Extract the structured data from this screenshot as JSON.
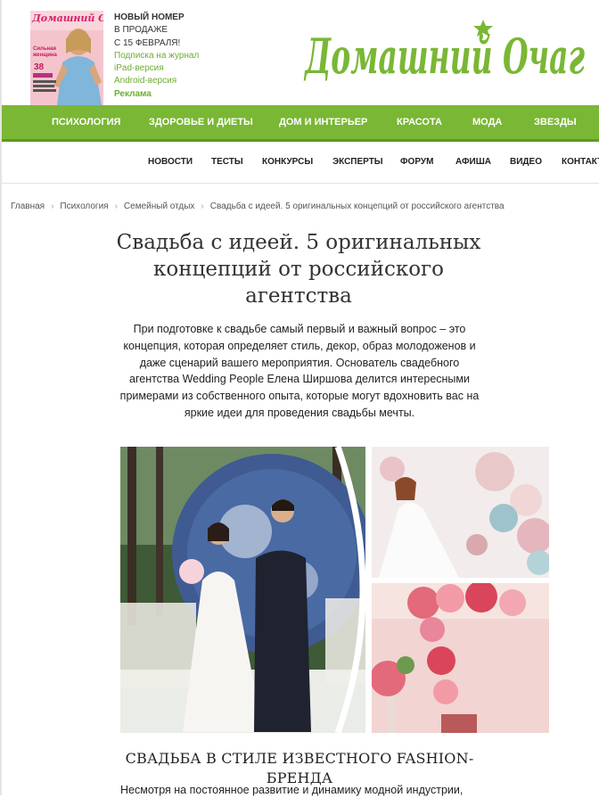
{
  "header": {
    "cover": {
      "masthead": "Домашний Очаг",
      "cover_line": "Сильная женщина",
      "cover_number": "38"
    },
    "promo": {
      "headline_1": "НОВЫЙ НОМЕР",
      "headline_2": "В ПРОДАЖЕ",
      "headline_3": "С 15 ФЕВРАЛЯ!",
      "subscribe_link": "Подписка на журнал",
      "ipad_link": "iPad-версия",
      "android_link": "Android-версия",
      "ad_link": "Реклама"
    },
    "logo_text": "Домашний Очаг",
    "brand_color": "#7ab735"
  },
  "main_nav": {
    "items": [
      "ПСИХОЛОГИЯ",
      "ЗДОРОВЬЕ И ДИЕТЫ",
      "ДОМ И ИНТЕРЬЕР",
      "КРАСОТА",
      "МОДА",
      "ЗВЕЗДЫ"
    ]
  },
  "sub_nav": {
    "items": [
      "НОВОСТИ",
      "ТЕСТЫ",
      "КОНКУРСЫ",
      "ЭКСПЕРТЫ",
      "ФОРУМ",
      "АФИША",
      "ВИДЕО",
      "КОНТАКТЫ"
    ]
  },
  "breadcrumb": {
    "items": [
      "Главная",
      "Психология",
      "Семейный отдых",
      "Свадьба с идеей. 5 оригинальных концепций от российского агентства"
    ]
  },
  "article": {
    "title": "Свадьба с идеей. 5 оригинальных концепций от российского агентства",
    "lead": "При подготовке к свадьбе самый первый и важный вопрос – это концепция, которая определяет стиль, декор, образ молодоженов и даже сценарий вашего мероприятия. Основатель свадебного агентства Wedding People Елена Ширшова делится интересными примерами из собственного опыта, которые могут вдохновить вас на яркие идеи для проведения свадьбы мечты.",
    "section_heading": "СВАДЬБА В СТИЛЕ ИЗВЕСТНОГО FASHION-БРЕНДА",
    "body_start": "Несмотря на постоянное развитие и динамику модной индустрии,"
  }
}
